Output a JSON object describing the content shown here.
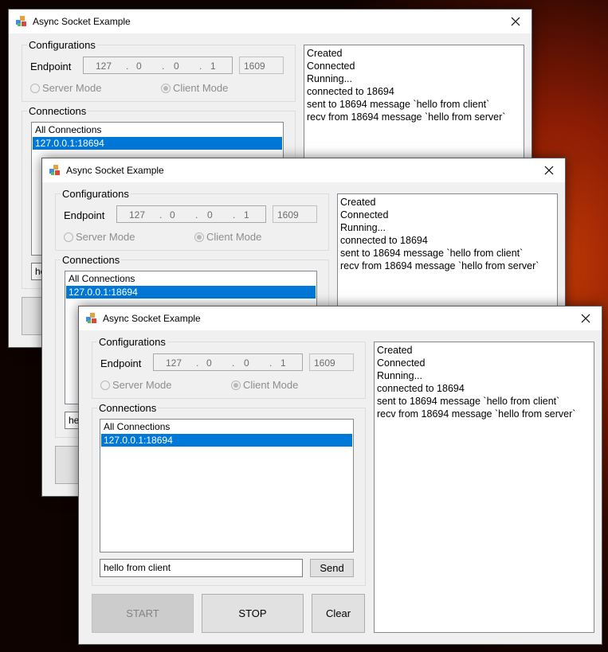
{
  "windows": [
    {
      "title": "Async Socket Example",
      "configurations_label": "Configurations",
      "endpoint_label": "Endpoint",
      "ip": [
        "127",
        "0",
        "0",
        "1"
      ],
      "port": "1609",
      "server_mode_label": "Server Mode",
      "client_mode_label": "Client Mode",
      "selected_mode": "client",
      "connections_label": "Connections",
      "connections": [
        "All Connections",
        "127.0.0.1:18694"
      ],
      "selected_connection": "127.0.0.1:18694",
      "message_input": "he",
      "log": [
        "Created",
        "Connected",
        "Running...",
        "connected to 18694",
        "sent to 18694 message `hello from client`",
        "recv from 18694 message `hello from server`"
      ]
    },
    {
      "title": "Async Socket Example",
      "configurations_label": "Configurations",
      "endpoint_label": "Endpoint",
      "ip": [
        "127",
        "0",
        "0",
        "1"
      ],
      "port": "1609",
      "server_mode_label": "Server Mode",
      "client_mode_label": "Client Mode",
      "selected_mode": "client",
      "connections_label": "Connections",
      "connections": [
        "All Connections",
        "127.0.0.1:18694"
      ],
      "selected_connection": "127.0.0.1:18694",
      "message_input": "he",
      "log": [
        "Created",
        "Connected",
        "Running...",
        "connected to 18694",
        "sent to 18694 message `hello from client`",
        "recv from 18694 message `hello from server`"
      ]
    },
    {
      "title": "Async Socket Example",
      "configurations_label": "Configurations",
      "endpoint_label": "Endpoint",
      "ip": [
        "127",
        "0",
        "0",
        "1"
      ],
      "port": "1609",
      "server_mode_label": "Server Mode",
      "client_mode_label": "Client Mode",
      "selected_mode": "client",
      "connections_label": "Connections",
      "connections": [
        "All Connections",
        "127.0.0.1:18694"
      ],
      "selected_connection": "127.0.0.1:18694",
      "message_input": "hello from client",
      "send_label": "Send",
      "start_label": "START",
      "stop_label": "STOP",
      "clear_label": "Clear",
      "log": [
        "Created",
        "Connected",
        "Running...",
        "connected to 18694",
        "sent to 18694 message `hello from client`",
        "recv from 18694 message `hello from server`"
      ]
    }
  ]
}
